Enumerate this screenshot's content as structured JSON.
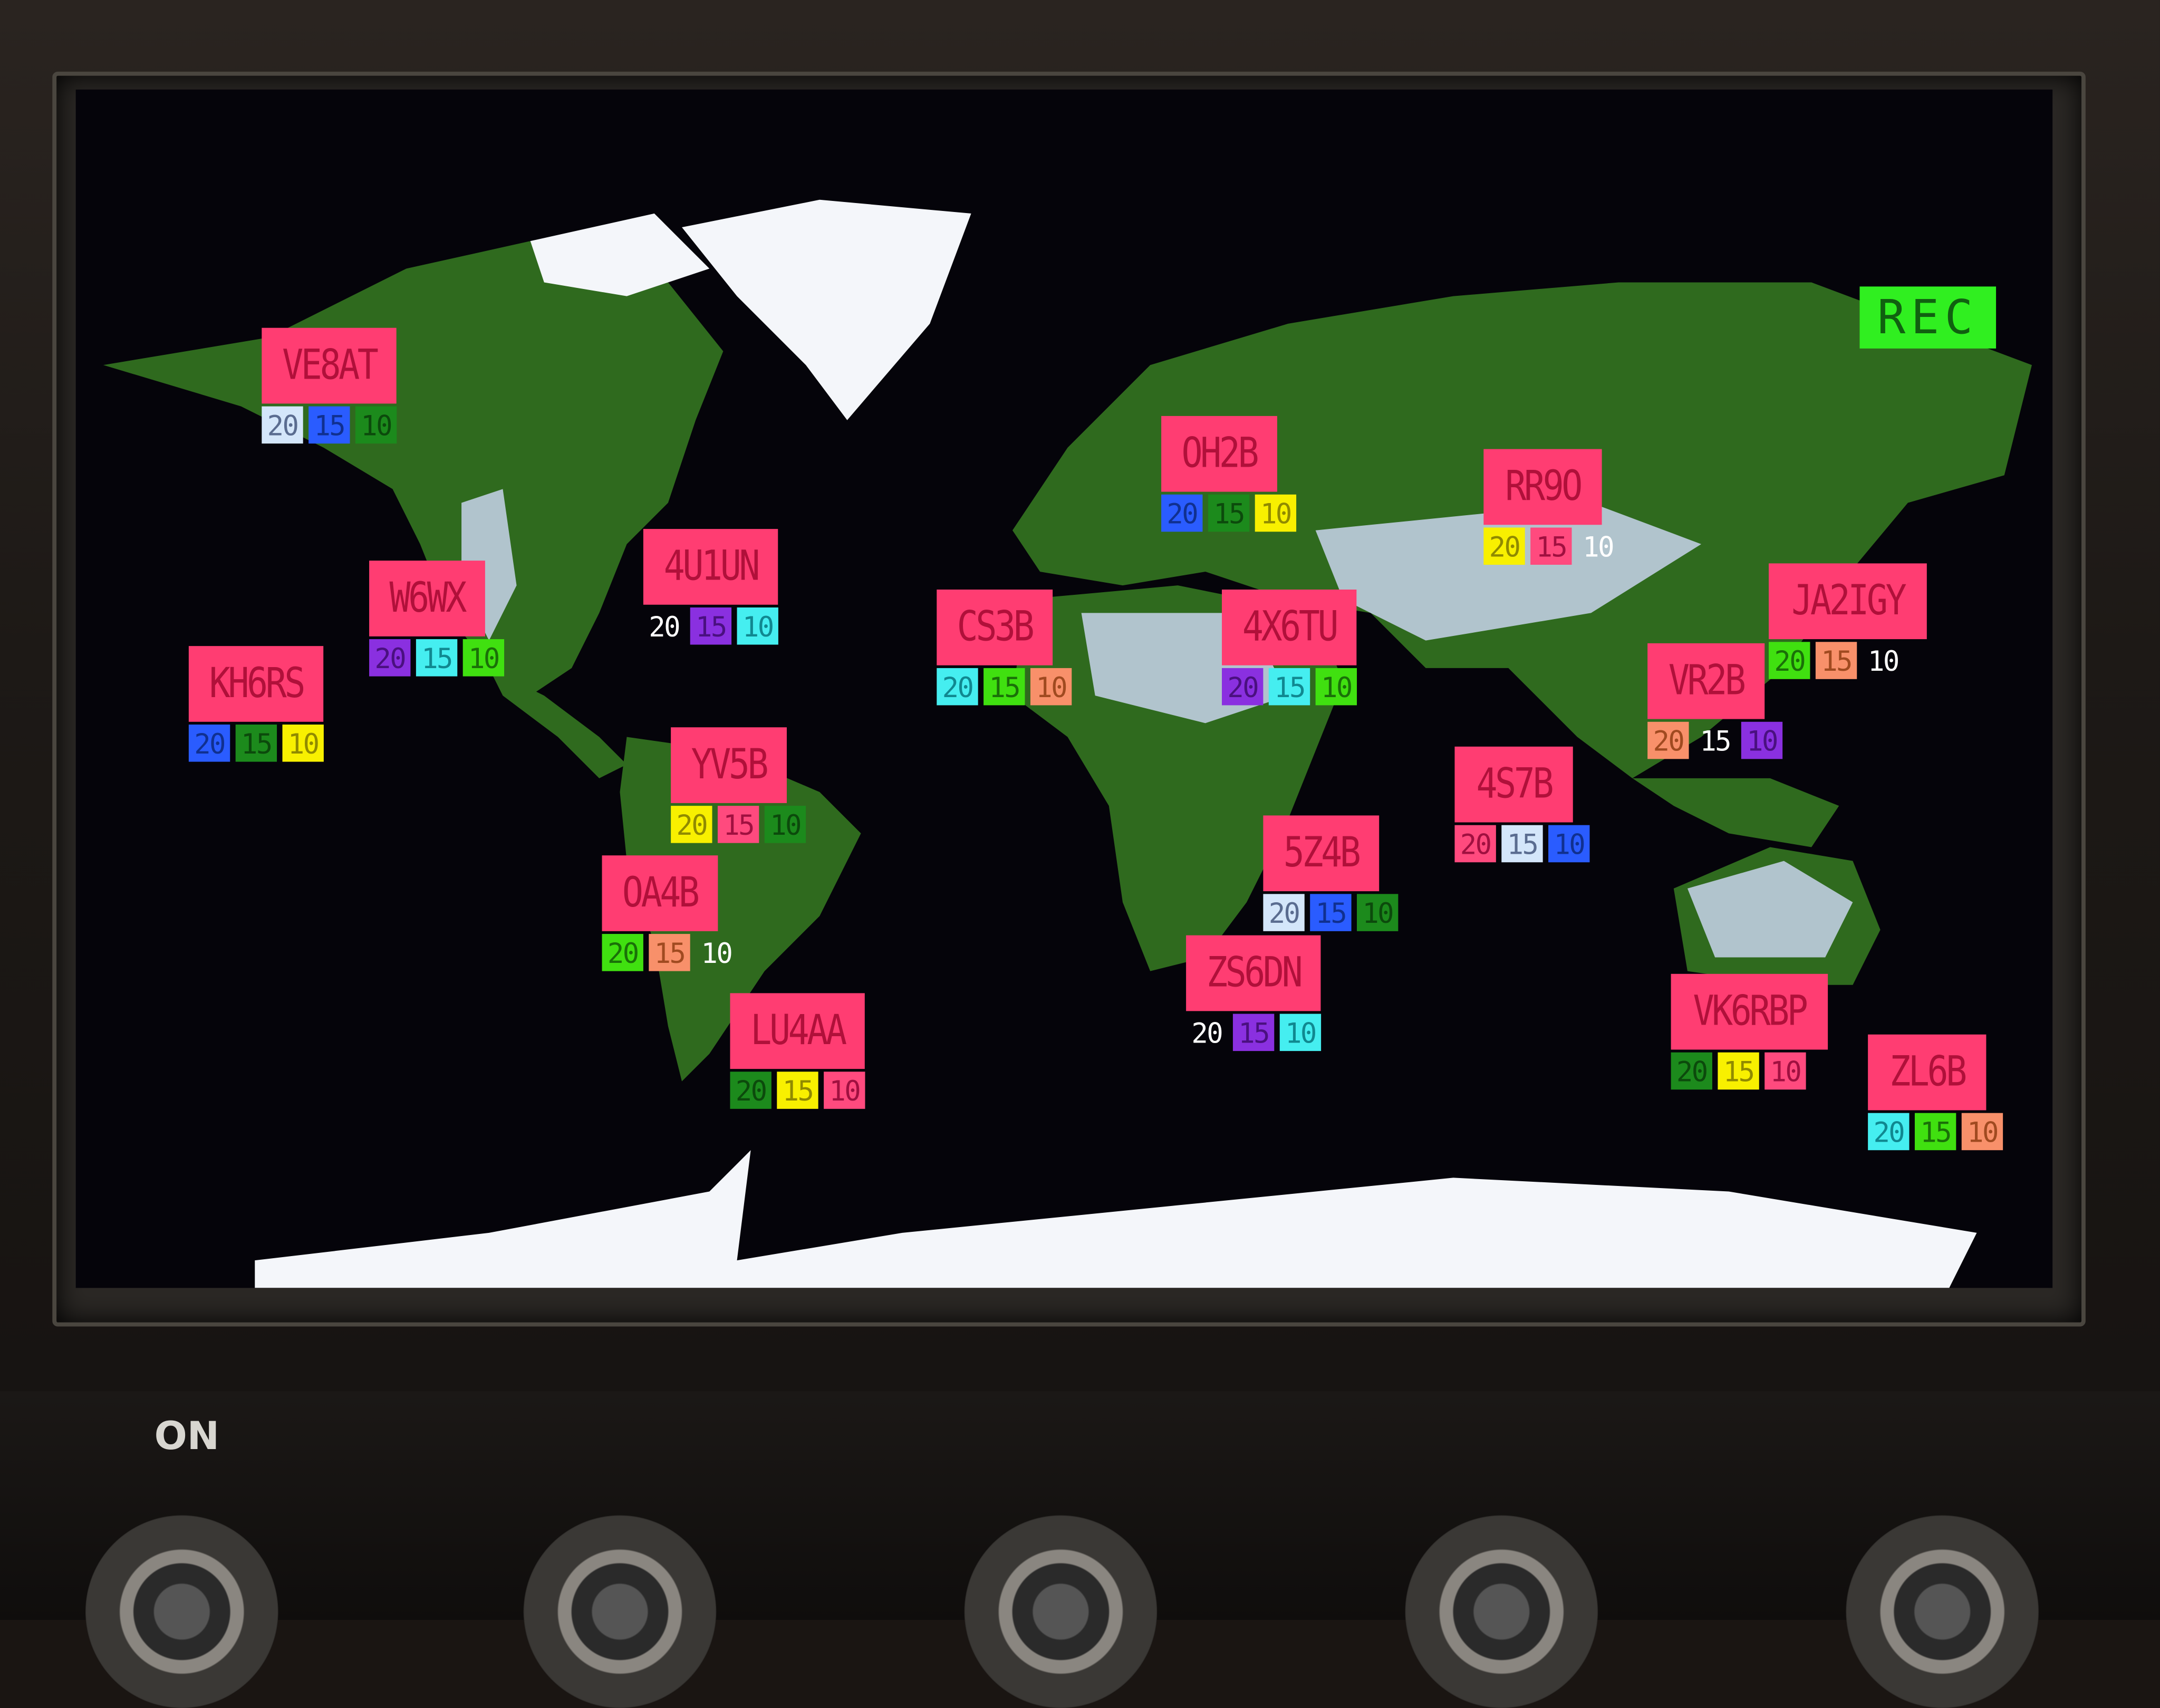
{
  "status": {
    "label": "REC"
  },
  "panel": {
    "power_label": "ON"
  },
  "band_colors": {
    "lightblue": "#d4e6fa",
    "blue": "#2a5cff",
    "darkgreen": "#1c8a1c",
    "purple": "#8a30e0",
    "cyan": "#45eef0",
    "lime": "#40e010",
    "yellow": "#f8f000",
    "pink": "#ff4a7e",
    "orange": "#f8906a",
    "none": "transparent"
  },
  "stations": [
    {
      "call": "VE8AT",
      "bands": [
        {
          "label": "20",
          "color": "lightblue"
        },
        {
          "label": "15",
          "color": "blue"
        },
        {
          "label": "10",
          "color": "darkgreen"
        }
      ]
    },
    {
      "call": "W6WX",
      "bands": [
        {
          "label": "20",
          "color": "purple"
        },
        {
          "label": "15",
          "color": "cyan"
        },
        {
          "label": "10",
          "color": "lime"
        }
      ]
    },
    {
      "call": "KH6RS",
      "bands": [
        {
          "label": "20",
          "color": "blue"
        },
        {
          "label": "15",
          "color": "darkgreen"
        },
        {
          "label": "10",
          "color": "yellow"
        }
      ]
    },
    {
      "call": "4U1UN",
      "bands": [
        {
          "label": "20",
          "color": "none"
        },
        {
          "label": "15",
          "color": "purple"
        },
        {
          "label": "10",
          "color": "cyan"
        }
      ]
    },
    {
      "call": "YV5B",
      "bands": [
        {
          "label": "20",
          "color": "yellow"
        },
        {
          "label": "15",
          "color": "pink"
        },
        {
          "label": "10",
          "color": "darkgreen"
        }
      ]
    },
    {
      "call": "OA4B",
      "bands": [
        {
          "label": "20",
          "color": "lime"
        },
        {
          "label": "15",
          "color": "orange"
        },
        {
          "label": "10",
          "color": "none"
        }
      ]
    },
    {
      "call": "LU4AA",
      "bands": [
        {
          "label": "20",
          "color": "darkgreen"
        },
        {
          "label": "15",
          "color": "yellow"
        },
        {
          "label": "10",
          "color": "pink"
        }
      ]
    },
    {
      "call": "CS3B",
      "bands": [
        {
          "label": "20",
          "color": "cyan"
        },
        {
          "label": "15",
          "color": "lime"
        },
        {
          "label": "10",
          "color": "orange"
        }
      ]
    },
    {
      "call": "OH2B",
      "bands": [
        {
          "label": "20",
          "color": "blue"
        },
        {
          "label": "15",
          "color": "darkgreen"
        },
        {
          "label": "10",
          "color": "yellow"
        }
      ]
    },
    {
      "call": "4X6TU",
      "bands": [
        {
          "label": "20",
          "color": "purple"
        },
        {
          "label": "15",
          "color": "cyan"
        },
        {
          "label": "10",
          "color": "lime"
        }
      ]
    },
    {
      "call": "5Z4B",
      "bands": [
        {
          "label": "20",
          "color": "lightblue"
        },
        {
          "label": "15",
          "color": "blue"
        },
        {
          "label": "10",
          "color": "darkgreen"
        }
      ]
    },
    {
      "call": "ZS6DN",
      "bands": [
        {
          "label": "20",
          "color": "none"
        },
        {
          "label": "15",
          "color": "purple"
        },
        {
          "label": "10",
          "color": "cyan"
        }
      ]
    },
    {
      "call": "RR9O",
      "bands": [
        {
          "label": "20",
          "color": "yellow"
        },
        {
          "label": "15",
          "color": "pink"
        },
        {
          "label": "10",
          "color": "none"
        }
      ]
    },
    {
      "call": "4S7B",
      "bands": [
        {
          "label": "20",
          "color": "pink"
        },
        {
          "label": "15",
          "color": "lightblue"
        },
        {
          "label": "10",
          "color": "blue"
        }
      ]
    },
    {
      "call": "VR2B",
      "bands": [
        {
          "label": "20",
          "color": "orange"
        },
        {
          "label": "15",
          "color": "none"
        },
        {
          "label": "10",
          "color": "purple"
        }
      ]
    },
    {
      "call": "JA2IGY",
      "bands": [
        {
          "label": "20",
          "color": "lime"
        },
        {
          "label": "15",
          "color": "orange"
        },
        {
          "label": "10",
          "color": "none"
        }
      ]
    },
    {
      "call": "VK6RBP",
      "bands": [
        {
          "label": "20",
          "color": "darkgreen"
        },
        {
          "label": "15",
          "color": "yellow"
        },
        {
          "label": "10",
          "color": "pink"
        }
      ]
    },
    {
      "call": "ZL6B",
      "bands": [
        {
          "label": "20",
          "color": "cyan"
        },
        {
          "label": "15",
          "color": "lime"
        },
        {
          "label": "10",
          "color": "orange"
        }
      ]
    }
  ]
}
